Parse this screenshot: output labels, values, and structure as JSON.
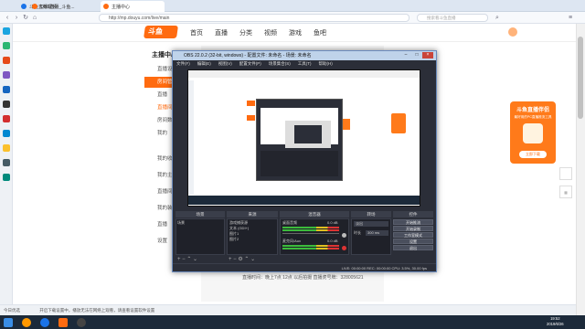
{
  "browser": {
    "tabs": [
      {
        "label": "斗鱼直播视频"
      },
      {
        "label": "OBS直播_斗鱼..."
      },
      {
        "label": "主播中心"
      }
    ],
    "url": "http://mp.douyu.com/live/main",
    "search_placeholder": "搜索看斗鱼直播"
  },
  "douyu": {
    "logo": "斗鱼",
    "nav": [
      "首页",
      "直播",
      "分类",
      "视频",
      "游戏",
      "鱼吧"
    ],
    "side_title": "主播中心",
    "side_items": [
      "直播设置",
      "房间管理",
      "直播",
      "直播间",
      "房间数据",
      "我的",
      "我的收益",
      "我的主播",
      "直播间",
      "我的装扮",
      "直播",
      "设置"
    ],
    "caption": "直播时间：晚上7点 12点 以后拍摄 直播虎号牌：328005621"
  },
  "promo": {
    "title": "斗鱼直播伴侣",
    "subtitle": "最好用的PC直播推流工具",
    "button": "立即下载"
  },
  "obs": {
    "title": "OBS 22.0.2 (32-bit, windows) - 配置文件: 未命名 - 场景: 未命名",
    "menu": [
      "文件(F)",
      "编辑(E)",
      "视图(V)",
      "配置文件(P)",
      "场景集合(S)",
      "工具(T)",
      "帮助(H)"
    ],
    "docks": [
      "场景",
      "来源",
      "混音器",
      "转场",
      "控件"
    ],
    "scene": "场景",
    "sources": [
      "游戏捕获源",
      "文本 (GDI+)",
      "图片1",
      "图片2"
    ],
    "mixer": [
      {
        "name": "桌面音频",
        "level": "0.0 dB"
      },
      {
        "name": "麦克风/Aux",
        "level": "0.0 dB"
      }
    ],
    "transition": "淡出",
    "duration_label": "时长",
    "duration": "300 ms",
    "controls": [
      "开始推流",
      "开始录制",
      "工作室模式",
      "设置",
      "退出"
    ],
    "status": "LIVE: 00:00:00   REC: 00:00:00   CPU: 3.5%, 30.00 fps"
  },
  "statusbar": {
    "left": "今日优选",
    "notice": "开启下载设置中，播放无法在网络上观看，请查看设置软件设置"
  },
  "taskbar": {
    "time": "19:52",
    "date": "2019/6/26"
  },
  "colors": {
    "accent": "#ff6b10",
    "obs_bg": "#2b2e38",
    "taskbar": "#1c2a3a"
  }
}
